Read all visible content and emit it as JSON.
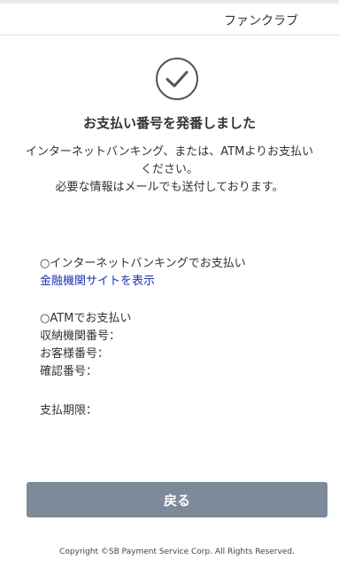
{
  "header": {
    "title": "ファンクラブ"
  },
  "completion": {
    "icon": "check-circle-icon",
    "title": "お支払い番号を発番しました",
    "message_line1": "インターネットバンキング、または、ATMよりお支払い",
    "message_line2": "ください。",
    "message_line3": "必要な情報はメールでも送付しております。"
  },
  "internet_banking": {
    "heading": "○インターネットバンキングでお支払い",
    "link_label": "金融機関サイトを表示"
  },
  "atm": {
    "heading": "○ATMでお支払い",
    "institution_number_label": "収納機関番号：",
    "customer_number_label": "お客様番号：",
    "confirmation_number_label": "確認番号："
  },
  "deadline": {
    "label": "支払期限："
  },
  "actions": {
    "back_label": "戻る"
  },
  "footer": {
    "copyright": "Copyright ©SB Payment Service Corp. All Rights Reserved."
  },
  "colors": {
    "button_background": "#7c8a9a",
    "link": "#1a33b3",
    "text": "#333333"
  }
}
